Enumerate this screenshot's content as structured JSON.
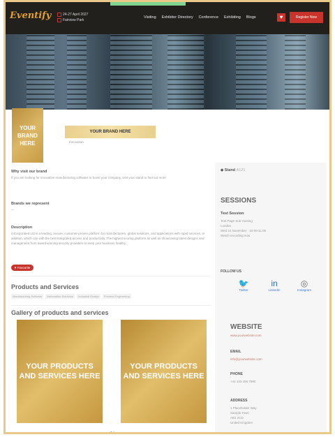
{
  "header": {
    "logo": "Eventify",
    "date": "24-27 April 2027",
    "venue": "Fairview Park",
    "nav": [
      "Visiting",
      "Exhibitor Directory",
      "Conference",
      "Exhibiting",
      "Blogs"
    ],
    "register_label": "Register Now"
  },
  "brand": {
    "logo_text": "YOUR BRAND HERE",
    "name_text": "YOUR BRAND HERE",
    "subtext": "Innovation"
  },
  "main": {
    "visit_label": "Why visit our brand",
    "visit_text": "If you are looking for innovative manufacturing software to boost your company, visit your stand to find out more",
    "brands_label": "Brands we represent",
    "brands_value": "—",
    "desc_label": "Description",
    "desc_text": "InCorporated Ltd is a leading, secure, customer-proven platform for manufacturers, global solutions, and applications with rapid services. In addition, which can with the best Integrated access and productivity. The highest scoring platform as well as showcasing latest designs and management from award-winning security providers to keep your business healthy.",
    "favourite_label": "Favourite",
    "products_title": "Products and Services",
    "product_tags": [
      "Manufacturing Software",
      "Automation Solutions",
      "Industrial Design",
      "Process Engineering"
    ],
    "gallery_title": "Gallery of products and services",
    "product_box_1": "YOUR PRODUCTS AND SERVICES HERE",
    "product_box_2": "YOUR PRODUCTS AND SERVICES HERE",
    "pager": "● •"
  },
  "sidebar": {
    "stand_label": "Stand",
    "stand_value": "A121",
    "sessions_title": "SESSIONS",
    "session_name": "Test Session",
    "session_host": "Test Page Sub Hosting",
    "session_location": "London",
    "session_time": "Wed 15 November · 10:00-11:00",
    "session_link": "Watch recording now",
    "follow_label": "FOLLOW US",
    "social": [
      "Twitter",
      "LinkedIn",
      "Instagram"
    ],
    "website_label": "WEBSITE",
    "website_value": "www.yourwebsite.com",
    "email_label": "EMAIL",
    "email_value": "info@yourwebsite.com",
    "phone_label": "PHONE",
    "phone_value": "+44 123 456 7890",
    "address_label": "ADDRESS",
    "address_lines": [
      "1 Placeholder Way",
      "Sample Town",
      "AB1 2CD",
      "United Kingdom"
    ]
  }
}
